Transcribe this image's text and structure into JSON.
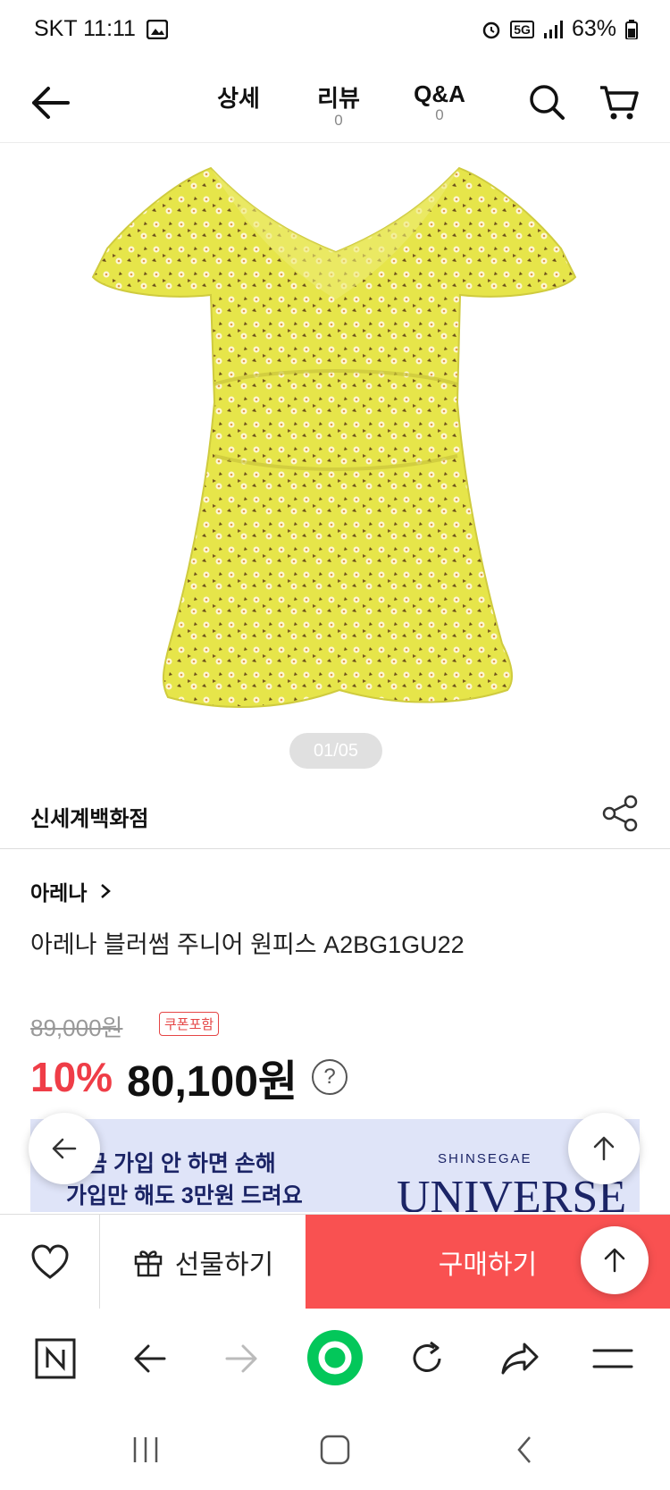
{
  "status_bar": {
    "carrier_time": "SKT 11:11",
    "network": "5G",
    "battery": "63%"
  },
  "top_nav": {
    "tabs": [
      {
        "label": "상세",
        "count": ""
      },
      {
        "label": "리뷰",
        "count": "0"
      },
      {
        "label": "Q&A",
        "count": "0"
      }
    ]
  },
  "gallery": {
    "counter": "01/05",
    "dress_color": "#e6e54a"
  },
  "store": {
    "name": "신세계백화점"
  },
  "product": {
    "brand": "아레나",
    "title": "아레나 블러썸 주니어 원피스 A2BG1GU22",
    "original_price": "89,000원",
    "coupon_badge": "쿠폰포함",
    "discount": "10%",
    "price": "80,100원",
    "help_icon": "?"
  },
  "banner": {
    "line1": "지금 가입 안 하면 손해",
    "line2": "가입만 해도 3만원 드려요",
    "brand_small": "SHINSEGAE",
    "brand_big": "UNIVERSE",
    "tag": "U"
  },
  "action_bar": {
    "gift_label": "선물하기",
    "buy_label": "구매하기"
  },
  "colors": {
    "accent_red": "#f95151",
    "discount_red": "#ef3d47",
    "banner_bg": "#dfe4f8",
    "naver_green": "#03c75a"
  }
}
